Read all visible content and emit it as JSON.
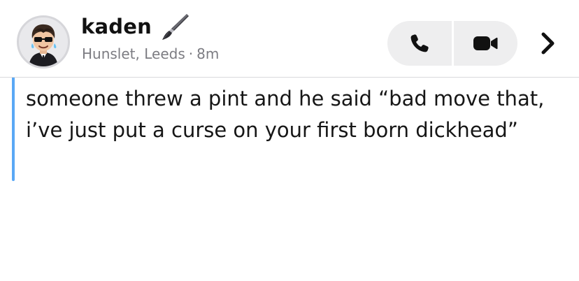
{
  "chat_header": {
    "friend_name": "kaden",
    "location": "Hunslet, Leeds",
    "separator_dot": "·",
    "time_ago": "8m",
    "name_emoji_icon": "paintbrush-icon",
    "avatar": "bitmoji-avatar",
    "call_buttons": [
      {
        "icon": "phone-icon"
      },
      {
        "icon": "video-camera-icon"
      }
    ],
    "more_icon": "chevron-right-icon"
  },
  "message": {
    "text": "someone threw a pint and he said “bad move that, i’ve just put a curse on your first born dickhead”",
    "accent_color": "#5aa8f5"
  }
}
